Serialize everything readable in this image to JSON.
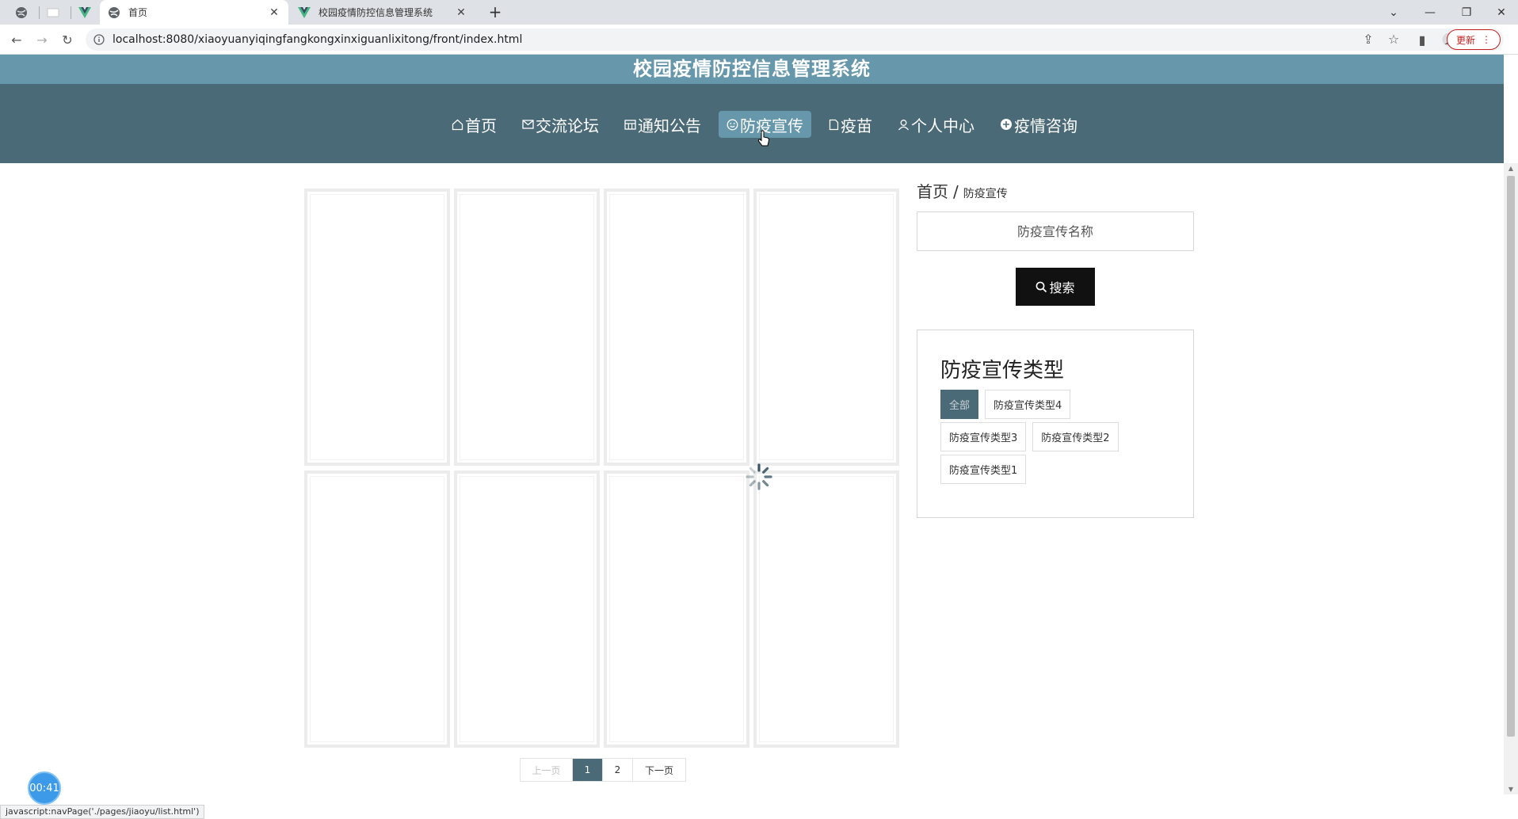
{
  "browser": {
    "tabs": [
      {
        "title": "首页",
        "icon": "globe-icon",
        "active": true
      },
      {
        "title": "校园疫情防控信息管理系统",
        "icon": "vue-logo-icon",
        "active": false
      }
    ],
    "url": "localhost:8080/xiaoyuanyiqingfangkongxinxiguanlixitong/front/index.html",
    "update_label": "更新"
  },
  "site": {
    "title": "校园疫情防控信息管理系统",
    "nav": [
      {
        "label": "首页",
        "icon": "home-icon"
      },
      {
        "label": "交流论坛",
        "icon": "mail-icon"
      },
      {
        "label": "通知公告",
        "icon": "grid-icon"
      },
      {
        "label": "防疫宣传",
        "icon": "smile-icon",
        "active": true
      },
      {
        "label": "疫苗",
        "icon": "document-icon"
      },
      {
        "label": "个人中心",
        "icon": "user-icon"
      },
      {
        "label": "疫情咨询",
        "icon": "chat-icon"
      }
    ]
  },
  "breadcrumb": {
    "home": "首页",
    "separator": "/",
    "current": "防疫宣传"
  },
  "search": {
    "placeholder": "防疫宣传名称",
    "button_label": "搜索"
  },
  "types": {
    "title": "防疫宣传类型",
    "items": [
      "全部",
      "防疫宣传类型4",
      "防疫宣传类型3",
      "防疫宣传类型2",
      "防疫宣传类型1"
    ],
    "active_index": 0
  },
  "pagination": {
    "prev": "上一页",
    "pages": [
      "1",
      "2"
    ],
    "current": "1",
    "next": "下一页"
  },
  "timer": "00:41",
  "status_url": "javascript:navPage('./pages/jiaoyu/list.html')",
  "colors": {
    "header": "#6697ab",
    "nav": "#4b6a77",
    "active": "#6697ab",
    "search_button": "#111111"
  }
}
